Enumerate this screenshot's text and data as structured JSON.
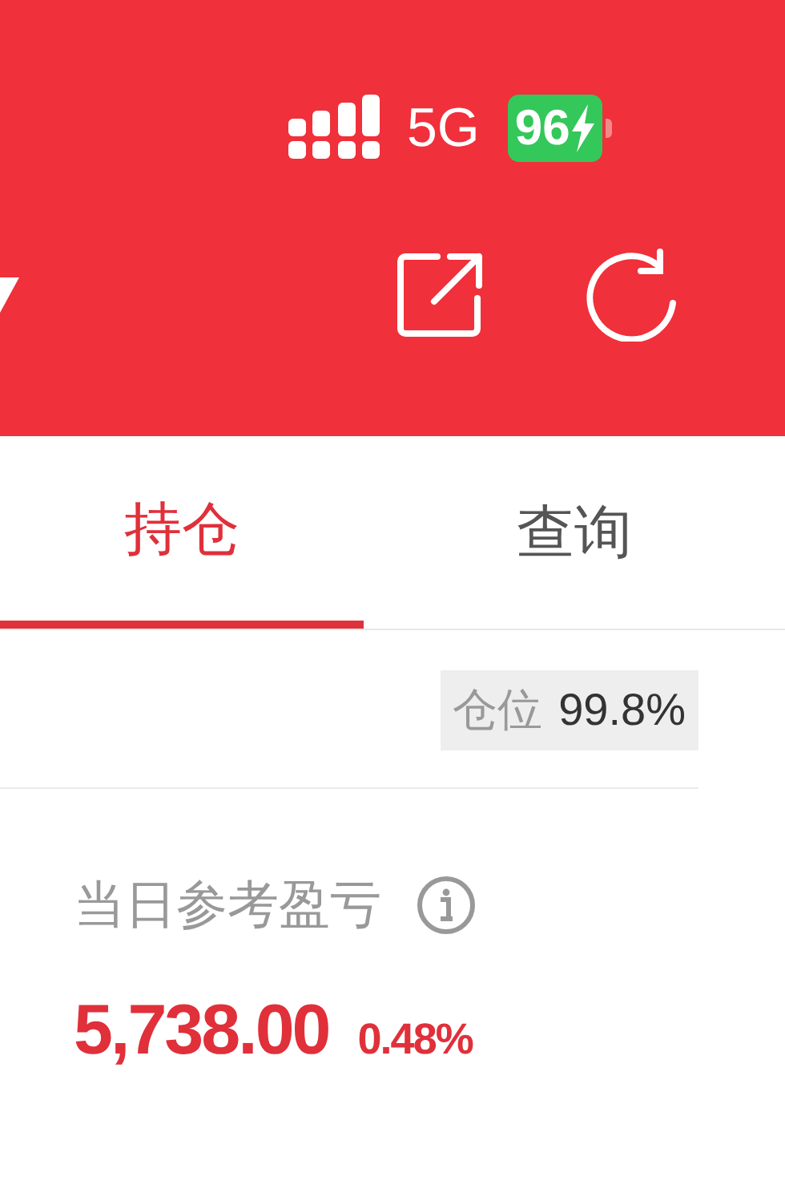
{
  "status_bar": {
    "network": "5G",
    "battery": "96",
    "charging": true
  },
  "tabs": [
    {
      "label": "持仓",
      "selected": true
    },
    {
      "label": "查询",
      "selected": false
    }
  ],
  "position": {
    "label": "仓位",
    "value": "99.8%"
  },
  "daily_pnl": {
    "label": "当日参考盈亏",
    "value": "5,738.00",
    "percent": "0.48%"
  }
}
